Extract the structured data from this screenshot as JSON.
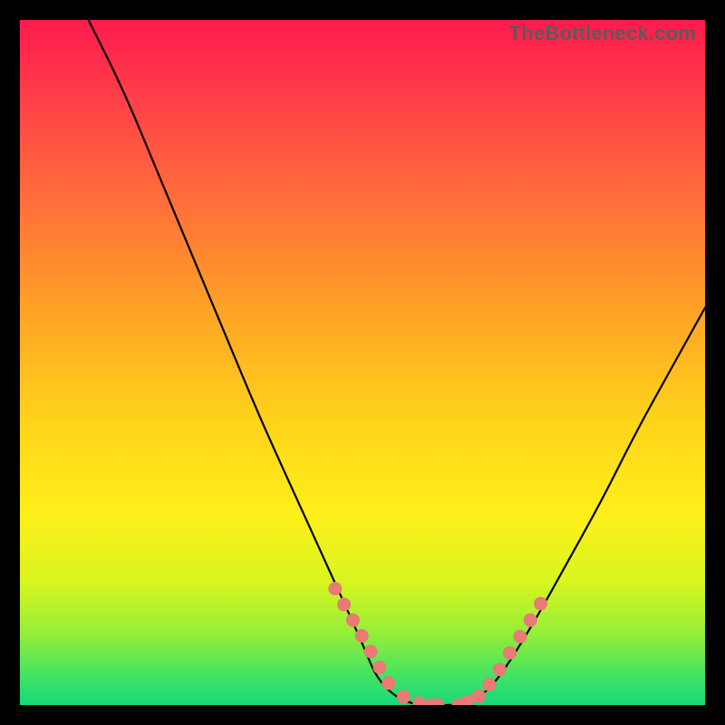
{
  "watermark": "TheBottleneck.com",
  "colors": {
    "background": "#000000",
    "curve": "#000000",
    "dots": "#e97a74"
  },
  "chart_data": {
    "type": "line",
    "title": "",
    "xlabel": "",
    "ylabel": "",
    "xlim": [
      0,
      100
    ],
    "ylim": [
      0,
      100
    ],
    "grid": false,
    "legend": false,
    "annotations": [
      "TheBottleneck.com"
    ],
    "note": "Values are estimated from the image on a 0–100 axis; curve is a V-shaped bottleneck profile with a flat near-zero minimum roughly between x≈52 and x≈67.",
    "series": [
      {
        "name": "curve",
        "x": [
          10,
          15,
          20,
          25,
          30,
          35,
          40,
          45,
          50,
          52,
          55,
          58,
          61,
          64,
          67,
          70,
          75,
          80,
          85,
          90,
          95,
          100
        ],
        "y": [
          100,
          90,
          78,
          66,
          54,
          42,
          31,
          20,
          9,
          4,
          1,
          0,
          0,
          0,
          1,
          4,
          12,
          21,
          30,
          40,
          49,
          58
        ]
      }
    ],
    "highlight_points": {
      "name": "dots_near_minimum",
      "x": [
        46,
        47.3,
        48.6,
        49.9,
        51.2,
        52.5,
        53.8,
        56.0,
        58.3,
        60.0,
        61.0,
        64.0,
        65.3,
        67.0,
        68.5,
        70.0,
        71.5,
        73.0,
        74.5,
        76.0
      ],
      "y": [
        17,
        14.7,
        12.4,
        10.1,
        7.8,
        5.5,
        3.2,
        1.2,
        0.3,
        0.0,
        0.0,
        0.0,
        0.5,
        1.3,
        3.0,
        5.2,
        7.6,
        10.0,
        12.4,
        14.8
      ]
    }
  }
}
